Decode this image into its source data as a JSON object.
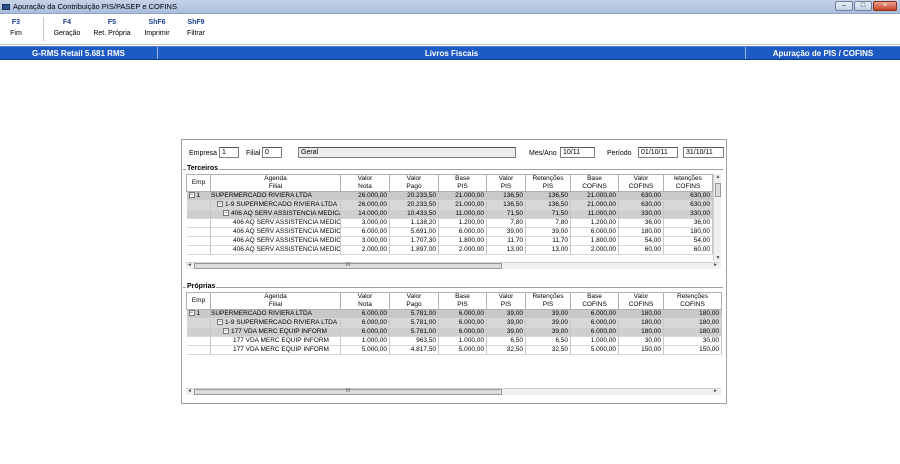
{
  "window": {
    "title": "Apuração da Contribuição PIS/PASEP e COFINS"
  },
  "toolbar": {
    "buttons": [
      {
        "key": "F3",
        "label": "Fim"
      },
      {
        "key": "F4",
        "label": "Geração"
      },
      {
        "key": "F5",
        "label": "Ret. Própria"
      },
      {
        "key": "ShF6",
        "label": "Imprimir"
      },
      {
        "key": "ShF9",
        "label": "Filtrar"
      }
    ]
  },
  "header": {
    "system": "G-RMS Retail 5.681 RMS",
    "module": "Livros Fiscais",
    "screen": "Apuração de PIS / COFINS"
  },
  "filters": {
    "empresa_label": "Empresa",
    "empresa_value": "1",
    "filial_label": "Filial",
    "filial_value": "0",
    "filial_desc": "Geral",
    "mesano_label": "Mes/Ano",
    "mesano_value": "10/11",
    "periodo_label": "Período",
    "periodo_from": "01/10/11",
    "periodo_to": "31/10/11"
  },
  "terceiros": {
    "title": "Terceiros",
    "columns": [
      {
        "top": "Emp",
        "bottom": ""
      },
      {
        "top": "Agenda",
        "bottom": "Filial"
      },
      {
        "top": "Valor",
        "bottom": "Nota"
      },
      {
        "top": "Valor",
        "bottom": "Pago"
      },
      {
        "top": "Base",
        "bottom": "PIS"
      },
      {
        "top": "Valor",
        "bottom": "PIS"
      },
      {
        "top": "Retenções",
        "bottom": "PIS"
      },
      {
        "top": "Base",
        "bottom": "COFINS"
      },
      {
        "top": "Valor",
        "bottom": "COFINS"
      },
      {
        "top": "letenções",
        "bottom": "COFINS"
      }
    ],
    "rows": [
      {
        "level": 0,
        "toggle": "−",
        "emp": "1",
        "desc": "SUPERMERCADO RIVIERA LTDA",
        "values": [
          "26.000,00",
          "20.233,50",
          "21.000,00",
          "136,50",
          "136,50",
          "21.000,00",
          "630,00",
          "630,00"
        ]
      },
      {
        "level": 1,
        "toggle": "−",
        "emp": "",
        "desc": "1-9 SUPERMERCADO RIVIERA LTDA",
        "values": [
          "26.000,00",
          "20.233,50",
          "21.000,00",
          "136,50",
          "136,50",
          "21.000,00",
          "630,00",
          "630,00"
        ]
      },
      {
        "level": 2,
        "toggle": "−",
        "emp": "",
        "desc": "406 AQ SERV ASSISTENCIA MEDICA",
        "values": [
          "14.000,00",
          "10.433,50",
          "11.000,00",
          "71,50",
          "71,50",
          "11.000,00",
          "330,00",
          "330,00"
        ]
      },
      {
        "level": 3,
        "toggle": "",
        "emp": "",
        "desc": "406 AQ SERV ASSISTENCIA MEDICA",
        "values": [
          "3.000,00",
          "1.138,20",
          "1.200,00",
          "7,80",
          "7,80",
          "1.200,00",
          "36,00",
          "36,00"
        ]
      },
      {
        "level": 3,
        "toggle": "",
        "emp": "",
        "desc": "406 AQ SERV ASSISTENCIA MEDICA",
        "values": [
          "6.000,00",
          "5.691,00",
          "6.000,00",
          "39,00",
          "39,00",
          "6.000,00",
          "180,00",
          "180,00"
        ]
      },
      {
        "level": 3,
        "toggle": "",
        "emp": "",
        "desc": "406 AQ SERV ASSISTENCIA MEDICA",
        "values": [
          "3.000,00",
          "1.707,30",
          "1.800,00",
          "11,70",
          "11,70",
          "1.800,00",
          "54,00",
          "54,00"
        ]
      },
      {
        "level": 3,
        "toggle": "",
        "emp": "",
        "desc": "406 AQ SERV ASSISTENCIA MEDICA",
        "values": [
          "2.000,00",
          "1.897,00",
          "2.000,00",
          "13,00",
          "13,00",
          "2.000,00",
          "60,00",
          "60,00"
        ]
      }
    ]
  },
  "proprias": {
    "title": "Próprias",
    "columns": [
      {
        "top": "Emp",
        "bottom": ""
      },
      {
        "top": "Agenda",
        "bottom": "Filial"
      },
      {
        "top": "Valor",
        "bottom": "Nota"
      },
      {
        "top": "Valor",
        "bottom": "Pago"
      },
      {
        "top": "Base",
        "bottom": "PIS"
      },
      {
        "top": "Valor",
        "bottom": "PIS"
      },
      {
        "top": "Retenções",
        "bottom": "PIS"
      },
      {
        "top": "Base",
        "bottom": "COFINS"
      },
      {
        "top": "Valor",
        "bottom": "COFINS"
      },
      {
        "top": "Retenções",
        "bottom": "COFINS"
      }
    ],
    "rows": [
      {
        "level": 0,
        "toggle": "−",
        "emp": "1",
        "desc": "SUPERMERCADO RIVIERA LTDA",
        "values": [
          "6.000,00",
          "5.781,00",
          "6.000,00",
          "39,00",
          "39,00",
          "6.000,00",
          "180,00",
          "180,00"
        ]
      },
      {
        "level": 1,
        "toggle": "−",
        "emp": "",
        "desc": "1-9 SUPERMERCADO RIVIERA LTDA",
        "values": [
          "6.000,00",
          "5.781,00",
          "6.000,00",
          "39,00",
          "39,00",
          "6.000,00",
          "180,00",
          "180,00"
        ]
      },
      {
        "level": 2,
        "toggle": "−",
        "emp": "",
        "desc": "177 VDA MERC EQUIP INFORM",
        "values": [
          "6.000,00",
          "5.781,00",
          "6.000,00",
          "39,00",
          "39,00",
          "6.000,00",
          "180,00",
          "180,00"
        ]
      },
      {
        "level": 3,
        "toggle": "",
        "emp": "",
        "desc": "177 VDA MERC EQUIP INFORM",
        "values": [
          "1.000,00",
          "963,50",
          "1.000,00",
          "6,50",
          "6,50",
          "1.000,00",
          "30,00",
          "30,00"
        ]
      },
      {
        "level": 3,
        "toggle": "",
        "emp": "",
        "desc": "177 VDA MERC EQUIP INFORM",
        "values": [
          "5.000,00",
          "4.817,50",
          "5.000,00",
          "32,50",
          "32,50",
          "5.000,00",
          "150,00",
          "150,00"
        ]
      }
    ]
  },
  "scrollbar_grip": "III"
}
